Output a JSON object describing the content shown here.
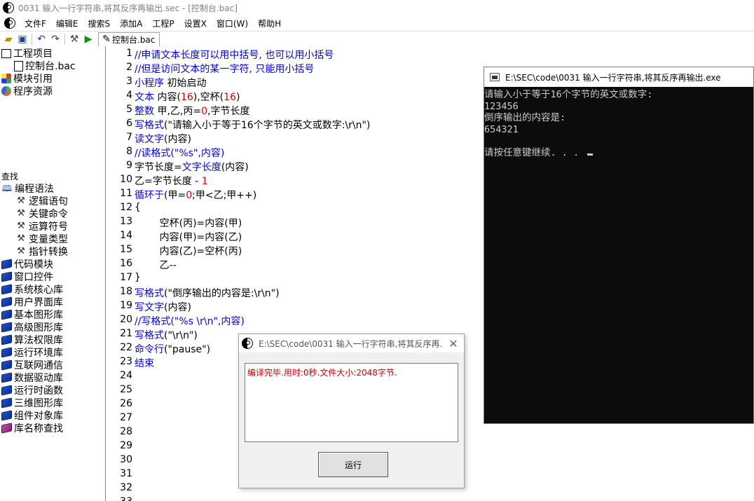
{
  "window": {
    "title": "0031 输入一行字符串,将其反序再输出.sec - [控制台.bac]"
  },
  "menu": [
    {
      "label": "文件F"
    },
    {
      "label": "编辑E"
    },
    {
      "label": "搜索S"
    },
    {
      "label": "添加A"
    },
    {
      "label": "工程P"
    },
    {
      "label": "设置X"
    },
    {
      "label": "窗口(W)"
    },
    {
      "label": "帮助H"
    }
  ],
  "toolbar": {
    "icons": [
      "open-folder-icon",
      "save-icon",
      "undo-icon",
      "redo-icon",
      "tools-icon",
      "run-icon"
    ],
    "doc_tab_label": "控制台.bac"
  },
  "tree": {
    "project": "工程项目",
    "file": "控制台.bac",
    "module_ref": "模块引用",
    "resources": "程序资源",
    "search_header": "查找",
    "syntax": "编程语法",
    "syntax_children": [
      "逻辑语句",
      "关键命令",
      "运算符号",
      "变量类型",
      "指针转换"
    ],
    "libraries": [
      "代码模块",
      "窗口控件",
      "系统核心库",
      "用户界面库",
      "基本图形库",
      "高级图形库",
      "算法权限库",
      "运行环境库",
      "互联网通信",
      "数据驱动库",
      "运行时函数",
      "三维图形库",
      "组件对象库"
    ],
    "lib_search": "库名称查找"
  },
  "editor": {
    "lines": [
      {
        "n": "1",
        "parts": [
          {
            "t": "//申请文本长度可以用中括号, 也可以用小括号",
            "c": "cmt"
          }
        ]
      },
      {
        "n": "2",
        "parts": [
          {
            "t": "//但是访问文本的某一字符, 只能用小括号",
            "c": "cmt"
          }
        ]
      },
      {
        "n": "3",
        "parts": [
          {
            "t": "小程序",
            "c": "kw"
          },
          {
            "t": " 初始启动",
            "c": ""
          }
        ]
      },
      {
        "n": "4",
        "parts": [
          {
            "t": "文本",
            "c": "kw"
          },
          {
            "t": " 内容(",
            "c": ""
          },
          {
            "t": "16",
            "c": "num"
          },
          {
            "t": "),空杯(",
            "c": ""
          },
          {
            "t": "16",
            "c": "num"
          },
          {
            "t": ")",
            "c": ""
          }
        ]
      },
      {
        "n": "5",
        "parts": [
          {
            "t": "整数",
            "c": "kw"
          },
          {
            "t": " 甲,乙,丙=",
            "c": ""
          },
          {
            "t": "0",
            "c": "num"
          },
          {
            "t": ",字节长度",
            "c": ""
          }
        ]
      },
      {
        "n": "6",
        "parts": [
          {
            "t": "写格式",
            "c": "kw"
          },
          {
            "t": "(\"请输入小于等于16个字节的英文或数字:\\r\\n\")",
            "c": ""
          }
        ]
      },
      {
        "n": "7",
        "parts": [
          {
            "t": "读文字",
            "c": "kw"
          },
          {
            "t": "(内容)",
            "c": ""
          }
        ]
      },
      {
        "n": "8",
        "parts": [
          {
            "t": "//读格式(\"%s\",内容)",
            "c": "cmt"
          }
        ]
      },
      {
        "n": "9",
        "parts": [
          {
            "t": "字节长度=",
            "c": ""
          },
          {
            "t": "文字长度",
            "c": "kw"
          },
          {
            "t": "(内容)",
            "c": ""
          }
        ]
      },
      {
        "n": "10",
        "parts": [
          {
            "t": "乙=字节长度 - ",
            "c": ""
          },
          {
            "t": "1",
            "c": "num"
          }
        ]
      },
      {
        "n": "11",
        "parts": [
          {
            "t": "循环于",
            "c": "kw"
          },
          {
            "t": "(甲=",
            "c": ""
          },
          {
            "t": "0",
            "c": "num"
          },
          {
            "t": ";甲<乙;甲++)",
            "c": ""
          }
        ]
      },
      {
        "n": "12",
        "parts": [
          {
            "t": "{",
            "c": ""
          }
        ]
      },
      {
        "n": "13",
        "parts": [
          {
            "t": "        空杯(丙)=内容(甲)",
            "c": ""
          }
        ]
      },
      {
        "n": "14",
        "parts": [
          {
            "t": "        内容(甲)=内容(乙)",
            "c": ""
          }
        ]
      },
      {
        "n": "15",
        "parts": [
          {
            "t": "        内容(乙)=空杯(丙)",
            "c": ""
          }
        ]
      },
      {
        "n": "16",
        "parts": [
          {
            "t": "        乙--",
            "c": ""
          }
        ]
      },
      {
        "n": "17",
        "parts": [
          {
            "t": "}",
            "c": ""
          }
        ]
      },
      {
        "n": "18",
        "parts": [
          {
            "t": "写格式",
            "c": "kw"
          },
          {
            "t": "(\"倒序输出的内容是:\\r\\n\")",
            "c": ""
          }
        ]
      },
      {
        "n": "19",
        "parts": [
          {
            "t": "写文字",
            "c": "kw"
          },
          {
            "t": "(内容)",
            "c": ""
          }
        ]
      },
      {
        "n": "20",
        "parts": [
          {
            "t": "//写格式(\"%s \\r\\n\",内容)",
            "c": "cmt"
          }
        ]
      },
      {
        "n": "21",
        "parts": [
          {
            "t": "写格式",
            "c": "kw"
          },
          {
            "t": "(\"\\r\\n\")",
            "c": ""
          }
        ]
      },
      {
        "n": "22",
        "parts": [
          {
            "t": "命令行",
            "c": "kw"
          },
          {
            "t": "(\"pause\")",
            "c": ""
          }
        ]
      },
      {
        "n": "23",
        "parts": [
          {
            "t": "结束",
            "c": "kw"
          }
        ]
      },
      {
        "n": "24",
        "parts": []
      },
      {
        "n": "25",
        "parts": []
      },
      {
        "n": "26",
        "parts": []
      },
      {
        "n": "27",
        "parts": []
      },
      {
        "n": "28",
        "parts": []
      },
      {
        "n": "29",
        "parts": []
      },
      {
        "n": "30",
        "parts": []
      },
      {
        "n": "31",
        "parts": []
      },
      {
        "n": "32",
        "parts": []
      },
      {
        "n": "33",
        "parts": []
      }
    ]
  },
  "console": {
    "title": "E:\\SEC\\code\\0031 输入一行字符串,将其反序再输出.exe",
    "lines": [
      "请输入小于等于16个字节的英文或数字:",
      "123456",
      "倒序输出的内容是:",
      "654321",
      "",
      "请按任意键继续. . . "
    ]
  },
  "dialog": {
    "title": "E:\\SEC\\code\\0031 输入一行字符串,将其反序再...",
    "close_glyph": "✕",
    "message": "编译完毕.用时:0秒.文件大小:2048字节.",
    "run_label": "运行"
  },
  "colors": {
    "keyword": "#0000ff",
    "number": "#e00000",
    "console_bg": "#0c0c0c",
    "console_fg": "#cccccc",
    "error_text": "#d00000"
  }
}
